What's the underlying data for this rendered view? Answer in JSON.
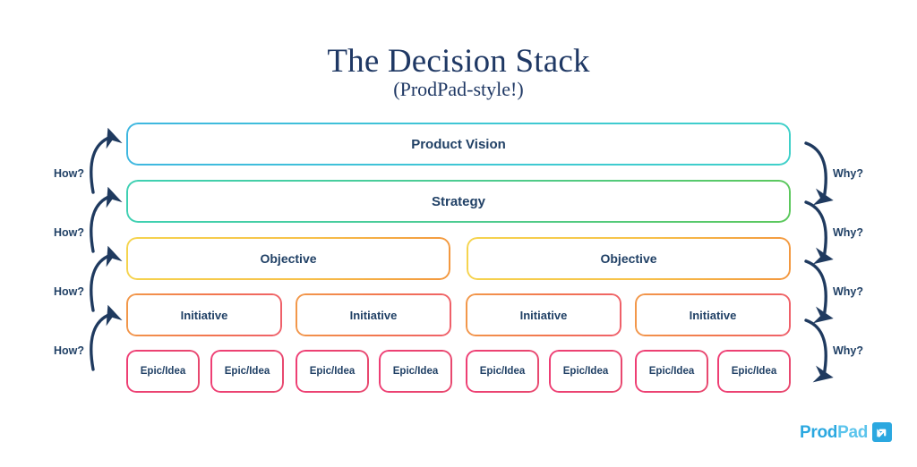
{
  "header": {
    "title": "The Decision Stack",
    "subtitle": "(ProdPad-style!)"
  },
  "colors": {
    "title": "#1f3864",
    "box_label": "#214166",
    "arrow": "#1f3a5f",
    "vision_start": "#3fb7e0",
    "vision_end": "#3fd0c9",
    "strategy_start": "#3fd0b3",
    "strategy_end": "#5cc85c",
    "objective_start": "#f5d44e",
    "objective_end": "#f3973f",
    "initiative_start": "#f2994a",
    "initiative_end": "#ef5f6b",
    "epic_start": "#ef3e75",
    "epic_end": "#e8486f",
    "logo_prod": "#2ba8e0",
    "logo_pad": "#5bc4ec"
  },
  "rows": [
    {
      "id": "vision",
      "level": 1,
      "boxes": [
        {
          "label": "Product Vision"
        }
      ]
    },
    {
      "id": "strategy",
      "level": 2,
      "boxes": [
        {
          "label": "Strategy"
        }
      ]
    },
    {
      "id": "objective",
      "level": 3,
      "boxes": [
        {
          "label": "Objective"
        },
        {
          "label": "Objective"
        }
      ]
    },
    {
      "id": "initiative",
      "level": 4,
      "boxes": [
        {
          "label": "Initiative"
        },
        {
          "label": "Initiative"
        },
        {
          "label": "Initiative"
        },
        {
          "label": "Initiative"
        }
      ]
    },
    {
      "id": "epic",
      "level": 5,
      "boxes": [
        {
          "label": "Epic/Idea"
        },
        {
          "label": "Epic/Idea"
        },
        {
          "label": "Epic/Idea"
        },
        {
          "label": "Epic/Idea"
        },
        {
          "label": "Epic/Idea"
        },
        {
          "label": "Epic/Idea"
        },
        {
          "label": "Epic/Idea"
        },
        {
          "label": "Epic/Idea"
        }
      ]
    }
  ],
  "left_arrows": {
    "label": "How?",
    "items": [
      {
        "label": "How?"
      },
      {
        "label": "How?"
      },
      {
        "label": "How?"
      },
      {
        "label": "How?"
      }
    ]
  },
  "right_arrows": {
    "label": "Why?",
    "items": [
      {
        "label": "Why?"
      },
      {
        "label": "Why?"
      },
      {
        "label": "Why?"
      },
      {
        "label": "Why?"
      }
    ]
  },
  "logo": {
    "text_bold": "Prod",
    "text_light": "Pad",
    "mark": "arrow-in-rounded-square-icon"
  }
}
